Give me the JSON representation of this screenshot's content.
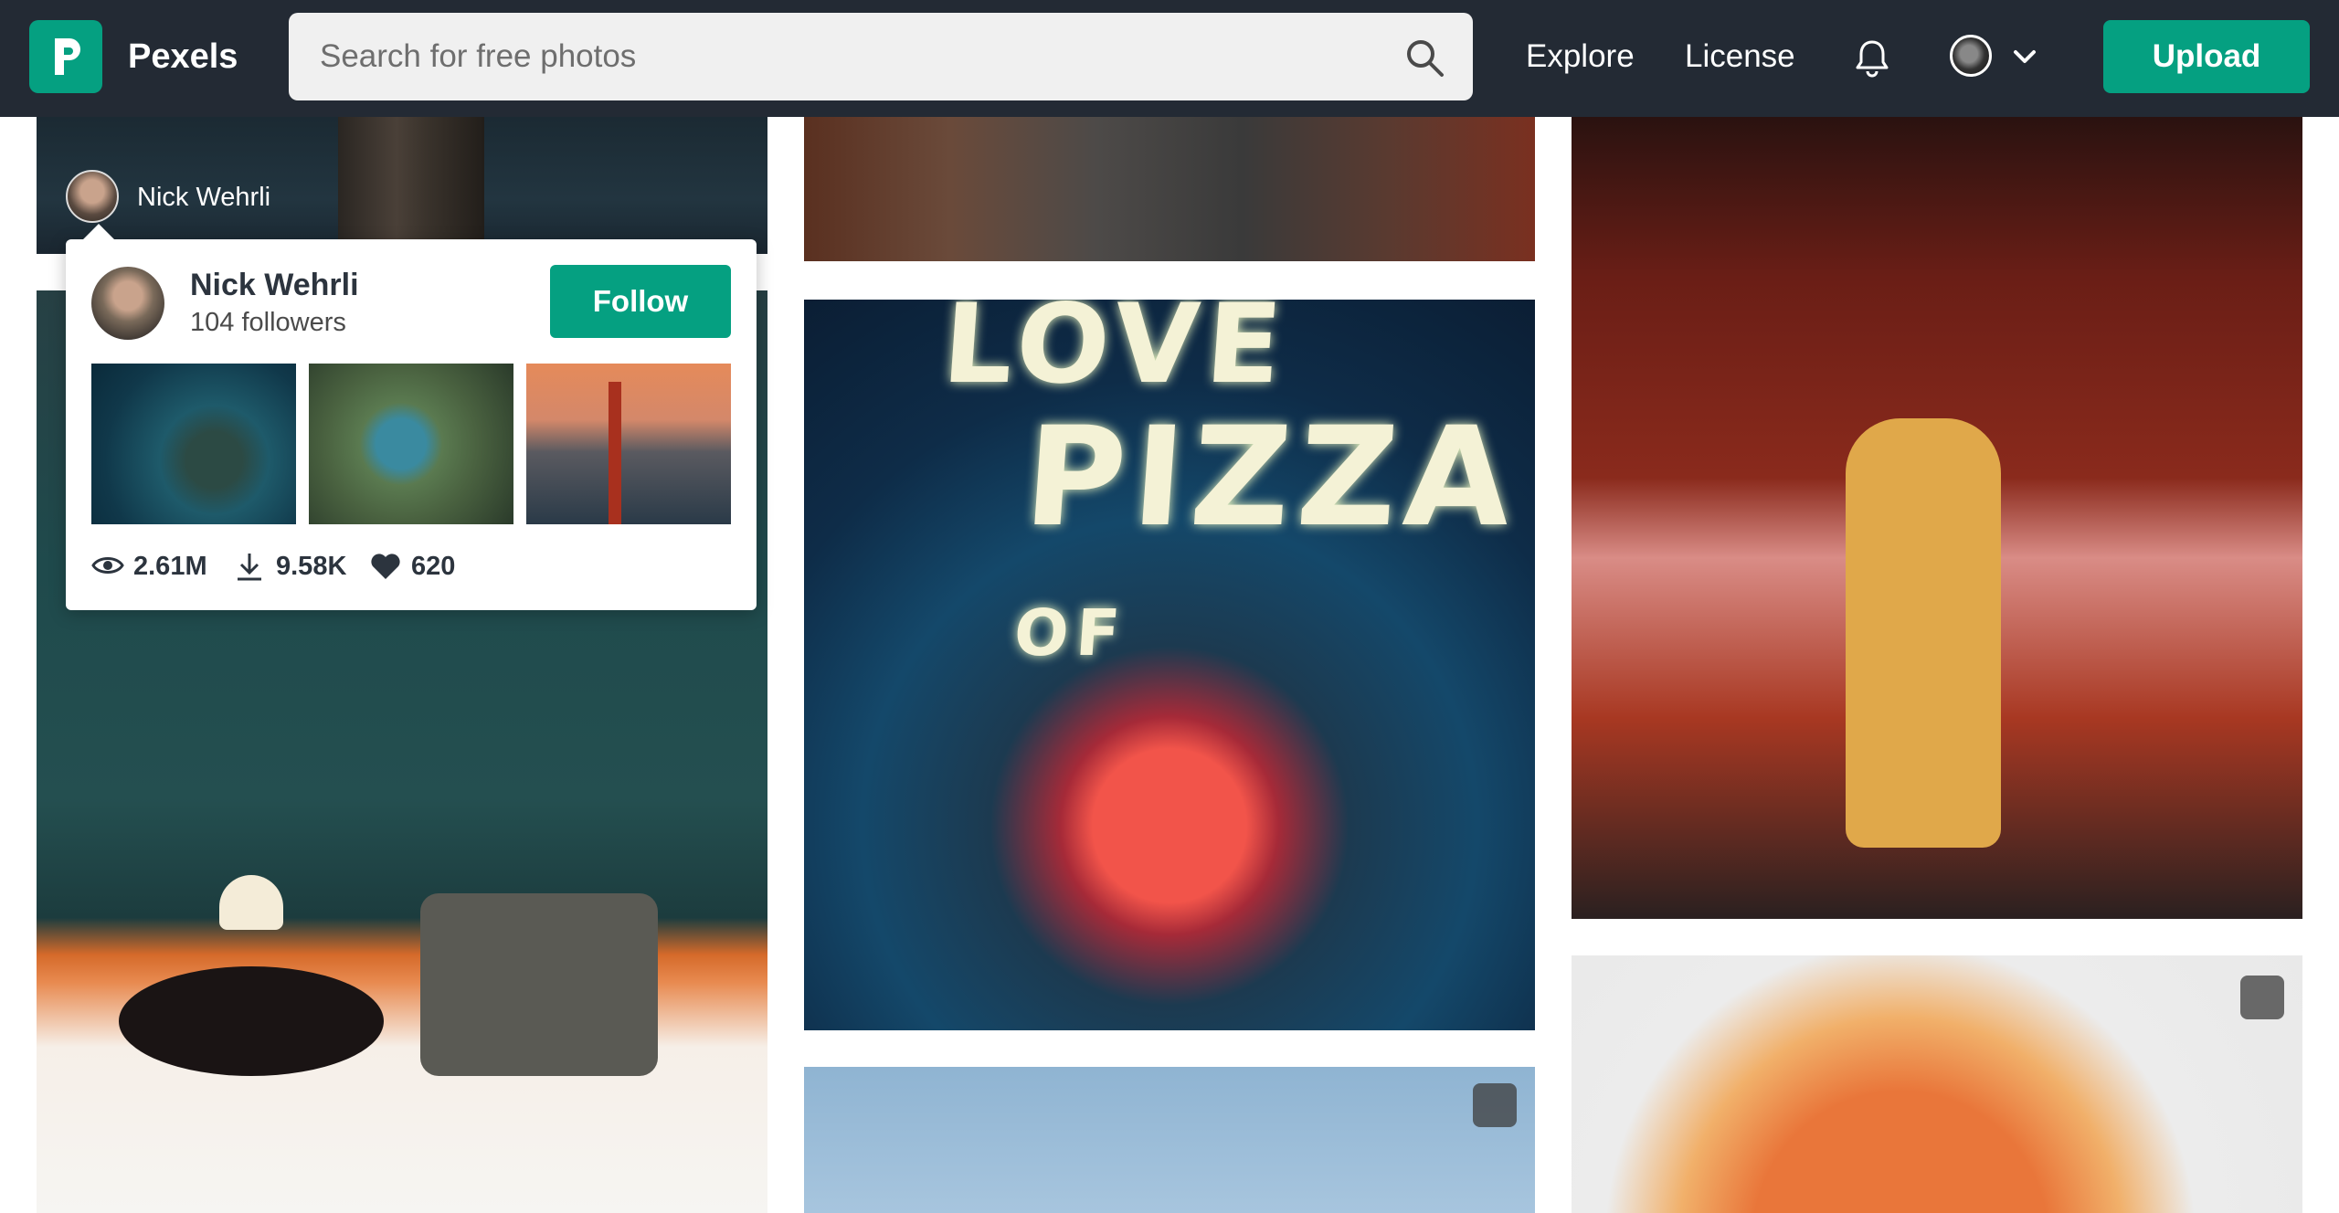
{
  "header": {
    "brand": "Pexels",
    "search_placeholder": "Search for free photos",
    "nav": {
      "explore": "Explore",
      "license": "License"
    },
    "upload_label": "Upload",
    "icons": [
      "pexels-logo-icon",
      "search-icon",
      "bell-icon",
      "chevron-down-icon"
    ]
  },
  "feed": {
    "first_photo_author": "Nick Wehrli"
  },
  "popover": {
    "name": "Nick Wehrli",
    "followers": "104 followers",
    "follow_label": "Follow",
    "stats": {
      "views": "2.61M",
      "downloads": "9.58K",
      "likes": "620"
    }
  },
  "pizza_sign": {
    "line1": "LOVE",
    "line2": "OF",
    "line3": "PIZZA"
  },
  "colors": {
    "brand_green": "#05a081",
    "header_bg": "#232a34"
  }
}
